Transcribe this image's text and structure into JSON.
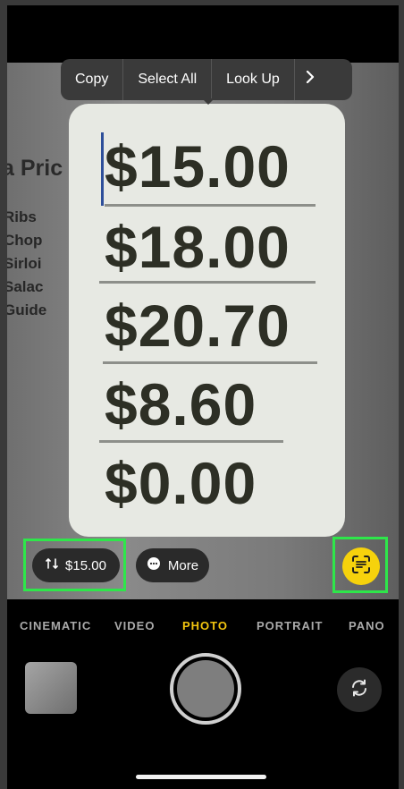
{
  "context_menu": {
    "items": [
      "Copy",
      "Select All",
      "Look Up"
    ],
    "more_icon": "chevron-right-icon"
  },
  "background_text": {
    "heading": "a Pric",
    "lines": [
      "Ribs",
      "Chop",
      "Sirloi",
      "Salac",
      "Guide"
    ]
  },
  "prices": [
    "$15.00",
    "$18.00",
    "$20.70",
    "$8.60",
    "$0.00"
  ],
  "actions": {
    "detected_price": "$15.00",
    "detected_price_icon": "currency-conversion-icon",
    "more_label": "More",
    "more_icon": "ellipsis-circle-icon",
    "live_text_icon": "live-text-icon"
  },
  "camera_modes": {
    "items": [
      "CINEMATIC",
      "VIDEO",
      "PHOTO",
      "PORTRAIT",
      "PANO"
    ],
    "active": "PHOTO"
  },
  "colors": {
    "accent_yellow": "#f6d20c",
    "highlight_green": "#2ee64a",
    "mode_active": "#f1c40f"
  }
}
